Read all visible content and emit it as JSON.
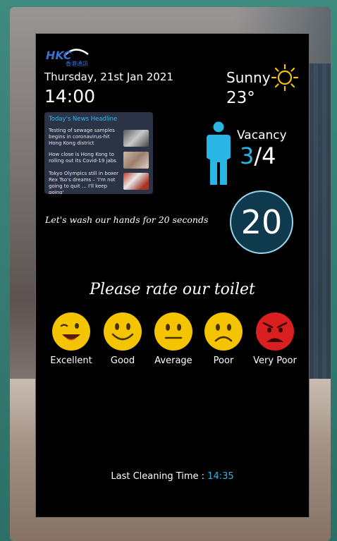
{
  "header": {
    "logo_text": "HKC",
    "logo_subtext": "香港通訊",
    "date": "Thursday, 21st Jan 2021",
    "time": "14:00"
  },
  "weather": {
    "condition": "Sunny",
    "temperature": "23°",
    "icon": "sun-icon"
  },
  "news": {
    "title": "Today's News Headline",
    "items": [
      {
        "text": "Testing of sewage samples begins in coronavirus-hit Hong Kong district"
      },
      {
        "text": "How close is Hong Kong to rolling out its Covid-19 jabs"
      },
      {
        "text": "Tokyo Olympics still in boxer Rex Tso's dreams – 'I'm not going to quit … I'll keep going'"
      }
    ]
  },
  "vacancy": {
    "label": "Vacancy",
    "current": "3",
    "separator": "/",
    "total": "4",
    "icon": "person-icon"
  },
  "handwash": {
    "message": "Let's wash our hands for 20 seconds",
    "timer": "20"
  },
  "rating": {
    "title": "Please rate our toilet",
    "options": [
      {
        "label": "Excellent",
        "icon": "wink-face-icon",
        "color": "#f5c400"
      },
      {
        "label": "Good",
        "icon": "smile-face-icon",
        "color": "#f5c400"
      },
      {
        "label": "Average",
        "icon": "neutral-face-icon",
        "color": "#f5c400"
      },
      {
        "label": "Poor",
        "icon": "frown-face-icon",
        "color": "#f5c400"
      },
      {
        "label": "Very Poor",
        "icon": "angry-face-icon",
        "color": "#d91f1f"
      }
    ]
  },
  "cleaning": {
    "label": "Last Cleaning Time : ",
    "value": "14:35"
  },
  "colors": {
    "accent": "#29b6e6",
    "panel_bg": "#000000",
    "news_bg": "#2b3447"
  }
}
